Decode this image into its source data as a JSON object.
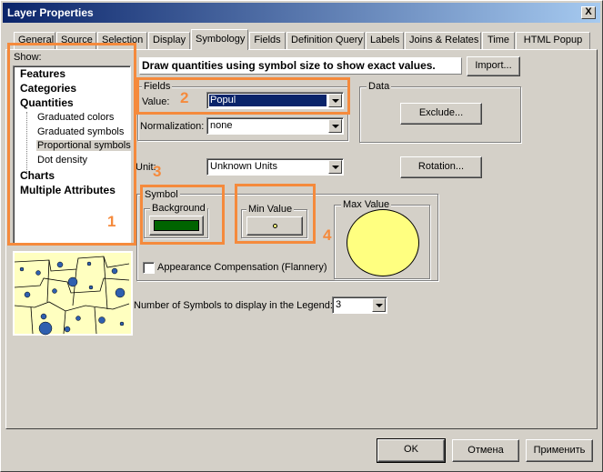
{
  "window": {
    "title": "Layer Properties",
    "close_glyph": "X"
  },
  "tabs": [
    {
      "label": "General"
    },
    {
      "label": "Source"
    },
    {
      "label": "Selection"
    },
    {
      "label": "Display"
    },
    {
      "label": "Symbology",
      "active": true
    },
    {
      "label": "Fields"
    },
    {
      "label": "Definition Query"
    },
    {
      "label": "Labels"
    },
    {
      "label": "Joins & Relates"
    },
    {
      "label": "Time"
    },
    {
      "label": "HTML Popup"
    }
  ],
  "show": {
    "label": "Show:",
    "items": [
      "Features",
      "Categories",
      "Quantities",
      "Graduated colors",
      "Graduated symbols",
      "Proportional symbols",
      "Dot density",
      "Charts",
      "Multiple Attributes"
    ],
    "selected": "Proportional symbols"
  },
  "description": "Draw quantities using symbol size to show exact values.",
  "import_label": "Import...",
  "fields": {
    "group_label": "Fields",
    "value_label": "Value:",
    "value": "Popul",
    "normalization_label": "Normalization:",
    "normalization": "none"
  },
  "data_group": {
    "label": "Data",
    "exclude_label": "Exclude..."
  },
  "unit": {
    "label": "Unit:",
    "value": "Unknown Units",
    "rotation_label": "Rotation..."
  },
  "symbol": {
    "group_label": "Symbol",
    "background_label": "Background",
    "background_color": "#006400",
    "min_label": "Min Value",
    "max_label": "Max Value",
    "max_color": "#ffff80"
  },
  "appearance_compensation": {
    "label": "Appearance Compensation (Flannery)",
    "checked": false
  },
  "legend_count": {
    "label": "Number of Symbols to display in the Legend:",
    "value": "3"
  },
  "annotations": [
    "1",
    "2",
    "3",
    "4"
  ],
  "footer": {
    "ok": "OK",
    "cancel": "Отмена",
    "apply": "Применить"
  },
  "colors": {
    "highlight": "#0a246a",
    "annotation": "#f58a3c"
  }
}
